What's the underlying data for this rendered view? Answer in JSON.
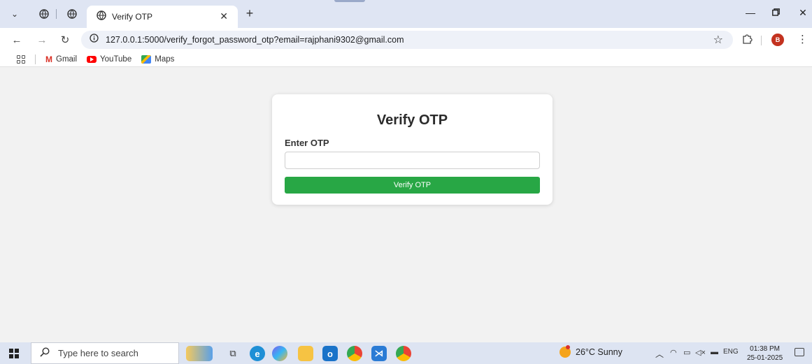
{
  "browser": {
    "active_tab_title": "Verify OTP",
    "address_url": "127.0.0.1:5000/verify_forgot_password_otp?email=rajphani9302@gmail.com",
    "profile_initial": "B"
  },
  "bookmarks": [
    {
      "label": "Gmail"
    },
    {
      "label": "YouTube"
    },
    {
      "label": "Maps"
    }
  ],
  "form": {
    "title": "Verify OTP",
    "otp_label": "Enter OTP",
    "otp_value": "",
    "submit_label": "Verify OTP",
    "accent_color": "#28a745"
  },
  "taskbar": {
    "search_placeholder": "Type here to search",
    "weather": "26°C  Sunny",
    "language": "ENG",
    "time": "01:38 PM",
    "date": "25-01-2025"
  }
}
